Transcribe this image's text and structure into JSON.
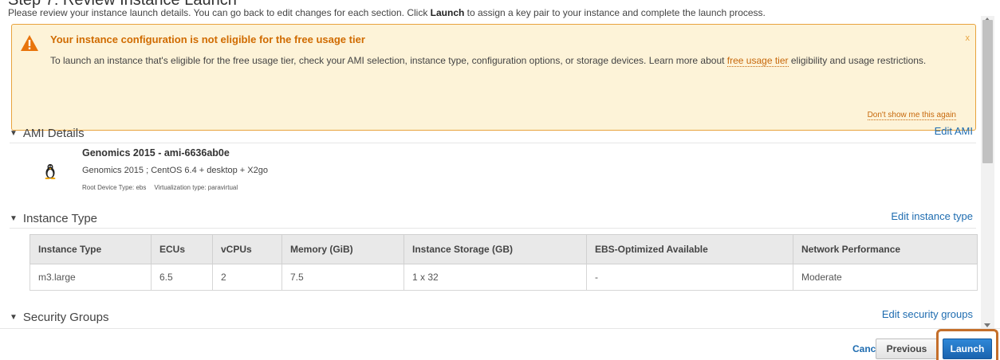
{
  "page": {
    "title": "Step 7: Review Instance Launch",
    "intro_before": "Please review your instance launch details. You can go back to edit changes for each section. Click ",
    "intro_bold": "Launch",
    "intro_after": " to assign a key pair to your instance and complete the launch process."
  },
  "warning": {
    "icon": "warning-triangle-icon",
    "title": "Your instance configuration is not eligible for the free usage tier",
    "close": "x",
    "body_before": "To launch an instance that's eligible for the free usage tier, check your AMI selection, instance type, configuration options, or storage devices. Learn more about ",
    "link": "free usage tier",
    "body_after": " eligibility and usage restrictions.",
    "dismiss": "Don't show me this again"
  },
  "ami": {
    "header": "AMI Details",
    "edit": "Edit AMI",
    "icon": "linux-penguin-icon",
    "name": "Genomics 2015 - ami-6636ab0e",
    "description": "Genomics 2015 ; CentOS 6.4 + desktop + X2go",
    "root_device": "Root Device Type: ebs",
    "virtualization": "Virtualization type: paravirtual"
  },
  "instance_type": {
    "header": "Instance Type",
    "edit": "Edit instance type",
    "columns": [
      "Instance Type",
      "ECUs",
      "vCPUs",
      "Memory (GiB)",
      "Instance Storage (GB)",
      "EBS-Optimized Available",
      "Network Performance"
    ],
    "rows": [
      [
        "m3.large",
        "6.5",
        "2",
        "7.5",
        "1 x 32",
        "-",
        "Moderate"
      ]
    ]
  },
  "security_groups": {
    "header": "Security Groups",
    "edit": "Edit security groups"
  },
  "footer": {
    "cancel": "Cancel",
    "previous": "Previous",
    "launch": "Launch"
  },
  "colors": {
    "warning_bg": "#fdf3d8",
    "warning_border": "#e8a33d",
    "warning_title": "#d06b00",
    "link": "#1e6cb0",
    "launch_button": "#1f6fbf",
    "launch_highlight": "#c46f2b"
  }
}
